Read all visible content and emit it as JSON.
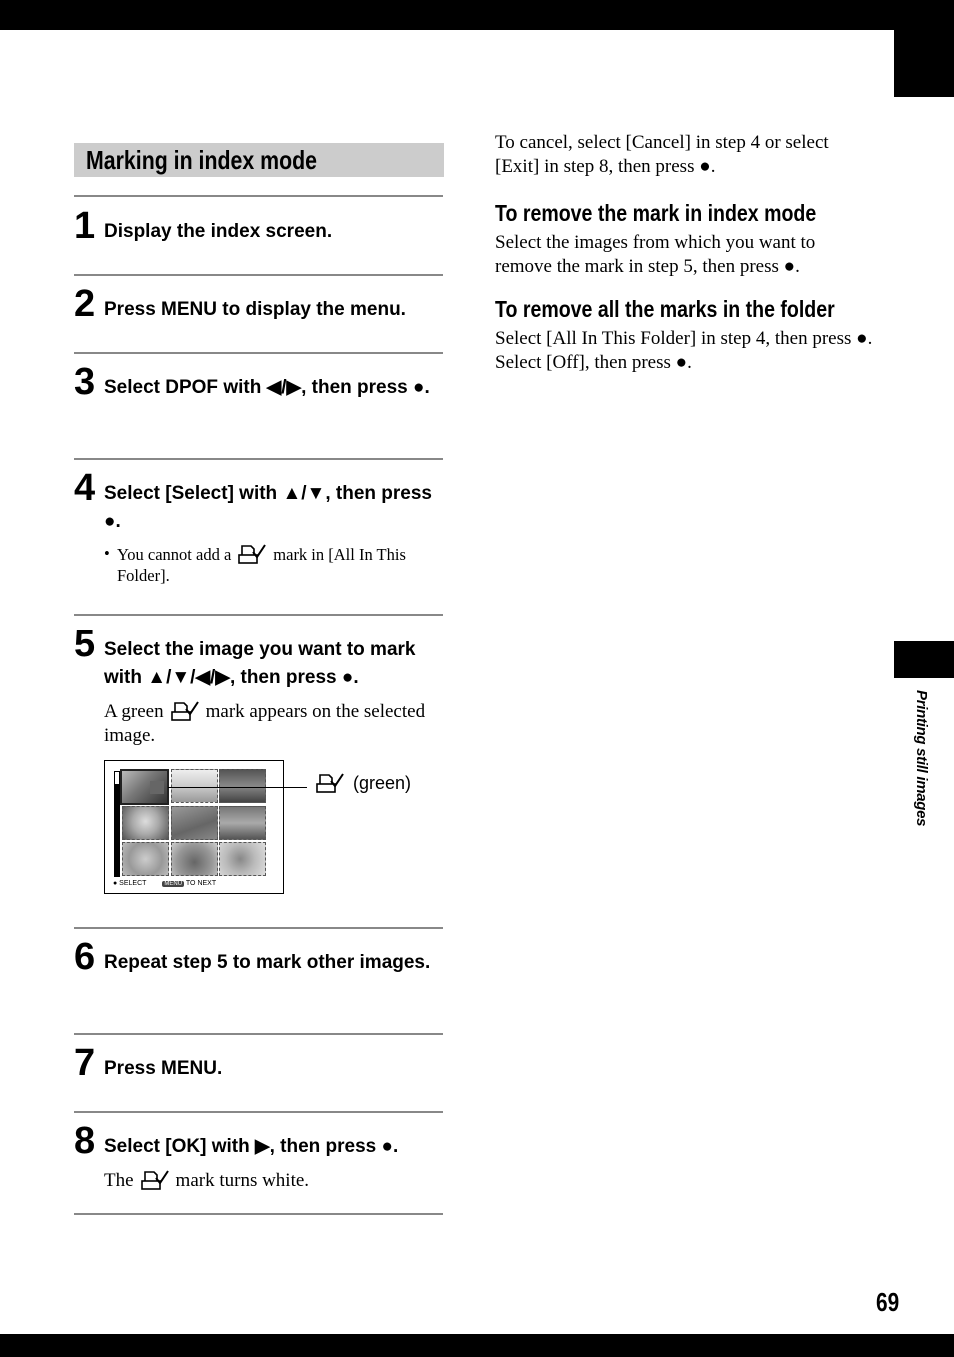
{
  "page": {
    "number": "69",
    "side_label": "Printing still images"
  },
  "section": {
    "title": "Marking in index mode"
  },
  "symbols": {
    "center_button": "●",
    "bullet": "•"
  },
  "steps": [
    {
      "num": "1",
      "text": "Display the index screen."
    },
    {
      "num": "2",
      "text": "Press MENU to display the menu."
    },
    {
      "num": "3",
      "text": "Select DPOF with ◀/▶, then press ●."
    },
    {
      "num": "4",
      "text": "Select [Select] with ▲/▼, then press ●.",
      "note_before_icon": "You cannot add a",
      "note_after_icon": "mark in [All In This Folder]."
    },
    {
      "num": "5",
      "text": "Select the image you want to mark with ▲/▼/◀/▶, then press ●.",
      "note_before_icon": "A green",
      "note_after_icon": "mark appears on the selected image."
    },
    {
      "num": "6",
      "text": "Repeat step 5 to mark other images."
    },
    {
      "num": "7",
      "text": "Press MENU."
    },
    {
      "num": "8",
      "text": "Select [OK] with ▶, then press ●.",
      "note_before_icon": "The",
      "note_after_icon": "mark turns white."
    }
  ],
  "lcd_screen": {
    "status_select": "● SELECT",
    "menu_chip": "MENU",
    "status_next": "TO NEXT",
    "callout_label": "(green)",
    "thumbnails": [
      {
        "subject": "two smiling people",
        "selected": true
      },
      {
        "subject": "landscape field",
        "selected": false
      },
      {
        "subject": "building",
        "selected": false
      },
      {
        "subject": "woman portrait",
        "selected": false
      },
      {
        "subject": "dog on grass",
        "selected": false
      },
      {
        "subject": "group of people",
        "selected": false
      },
      {
        "subject": "rose flower",
        "selected": false
      },
      {
        "subject": "flower bouquet",
        "selected": false
      },
      {
        "subject": "woman portrait",
        "selected": false
      }
    ]
  },
  "right_column": {
    "cancel_text": "To cancel, select [Cancel] in step 4 or select [Exit] in step 8, then press ●.",
    "remove_mark_heading": "To remove the mark in index mode",
    "remove_mark_text": "Select the images from which you want to remove the mark in step 5, then press ●.",
    "remove_all_heading": "To remove all the marks in the folder",
    "remove_all_text": "Select [All In This Folder] in step 4, then press ●. Select [Off], then press ●."
  }
}
